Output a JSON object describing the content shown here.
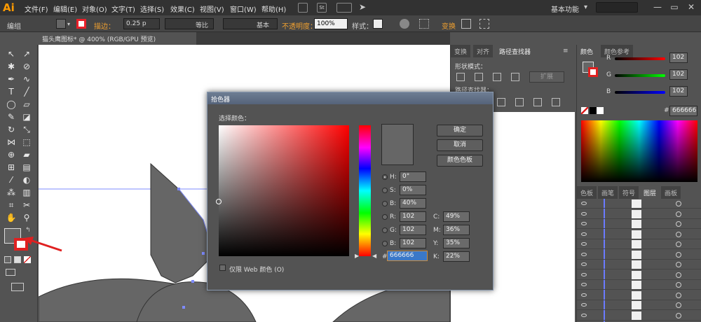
{
  "app": {
    "logo": "Ai",
    "doc_title": "猫头鹰图标* @ 400% (RGB/GPU 预览)",
    "workspace": "基本功能"
  },
  "menu": [
    "文件(F)",
    "编辑(E)",
    "对象(O)",
    "文字(T)",
    "选择(S)",
    "效果(C)",
    "视图(V)",
    "窗口(W)",
    "帮助(H)"
  ],
  "menu_badge": "St",
  "control_bar": {
    "selection": "编组",
    "stroke_label": "描边：",
    "stroke_weight": "0.25 p",
    "profile1": "等比",
    "profile2": "基本",
    "opacity_label": "不透明度：",
    "opacity_value": "100%",
    "style_label": "样式：",
    "transform": "变换"
  },
  "panel_tabs": {
    "transform": "变换",
    "align": "对齐",
    "pathfinder": "路径查找器"
  },
  "pathfinder": {
    "shape_modes": "形状模式：",
    "expand": "扩展",
    "pathfinders": "路径查找器："
  },
  "color_panel": {
    "tab1": "颜色",
    "tab2": "颜色参考",
    "r_label": "R",
    "g_label": "G",
    "b_label": "B",
    "r": "102",
    "g": "102",
    "b": "102",
    "hex_hash": "#",
    "hex": "666666"
  },
  "layer_tabs": [
    "色板",
    "画笔",
    "符号",
    "图层",
    "画板"
  ],
  "color_picker": {
    "title": "拾色器",
    "select_label": "选择颜色：",
    "ok": "确定",
    "cancel": "取消",
    "swatches": "颜色色板",
    "h_label": "H:",
    "h": "0°",
    "s_label": "S:",
    "s": "0%",
    "b_label": "B:",
    "b": "40%",
    "r_label": "R:",
    "r": "102",
    "g_label": "G:",
    "g": "102",
    "bb_label": "B:",
    "bb": "102",
    "hash": "#",
    "hex": "666666",
    "c_label": "C:",
    "c": "49%",
    "m_label": "M:",
    "m": "36%",
    "y_label": "Y:",
    "y": "35%",
    "k_label": "K:",
    "k": "22%",
    "web_only": "仅限 Web 颜色 (O)"
  },
  "colors": {
    "fill": "#666666",
    "accent": "#f0a030",
    "selection": "#6b7bff"
  }
}
